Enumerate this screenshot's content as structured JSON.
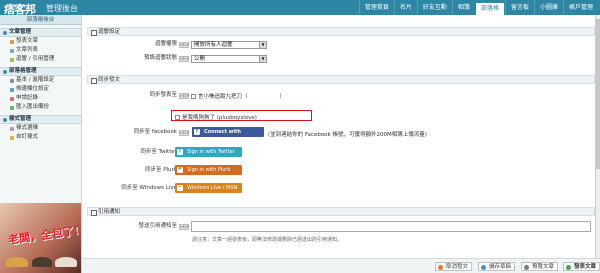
{
  "app": {
    "logo": "痞客邦",
    "subtitle": "管理後台"
  },
  "topnav": [
    {
      "label": "管理首頁",
      "active": false
    },
    {
      "label": "名片",
      "active": false
    },
    {
      "label": "好友互動",
      "active": false
    },
    {
      "label": "相簿",
      "active": false
    },
    {
      "label": "部落格",
      "active": true
    },
    {
      "label": "留言板",
      "active": false
    },
    {
      "label": "小圖庫",
      "active": false
    },
    {
      "label": "帳戶管理",
      "active": false
    }
  ],
  "sidebar": {
    "title": "部落格後台",
    "groups": [
      {
        "label": "文章管理",
        "items": [
          "發表文章",
          "文章列表",
          "迴響 / 引用管理"
        ]
      },
      {
        "label": "部落格管理",
        "items": [
          "基本 / 進階設定",
          "側邊欄位設定",
          "申請記錄",
          "匯入匯出備份"
        ]
      },
      {
        "label": "樣式管理",
        "items": [
          "樣式選擇",
          "自訂樣式"
        ]
      }
    ],
    "promo_text": "老闆，全包了!"
  },
  "form": {
    "sec_reply": "迴響設定",
    "reply_permission_label": "迴響權限",
    "reply_permission_value": "開放所有人迴響",
    "display_status_label": "預設迴響狀態",
    "display_status_value": "公開",
    "sec_sync": "同步發文",
    "sync_label": "同步發表至",
    "sync_opt1": "言小樵追蹤九把刀（",
    "sync_opt1_suffix": "）",
    "sync_opt2": "是我嗎狗狗了 (plusboyslove)",
    "facebook_label": "同步至 facebook",
    "facebook_btn": "Connect with Facebook",
    "facebook_note": "(並到連結你的 Facebook 帳號，可獲得額外200M相簿上傳流量)",
    "twitter_label": "同步至 Twitter",
    "twitter_btn": "Sign in with Twitter",
    "plurk_label": "同步至 Plurk",
    "plurk_btn": "Sign in with Plurk",
    "wlive_label": "同步至 Windows Live",
    "wlive_btn": "Windows Live / MSN",
    "sec_trackback": "引用通知",
    "trackback_label": "發送引用通知至",
    "trackback_note": "請注意：文章一經發表後，即無法修改或刪除已經送出的引用通知。",
    "help": "HELP"
  },
  "toolbar": {
    "cancel": "取消發文",
    "draft": "儲存草稿",
    "preview": "預覽文章",
    "publish": "發表文章"
  }
}
